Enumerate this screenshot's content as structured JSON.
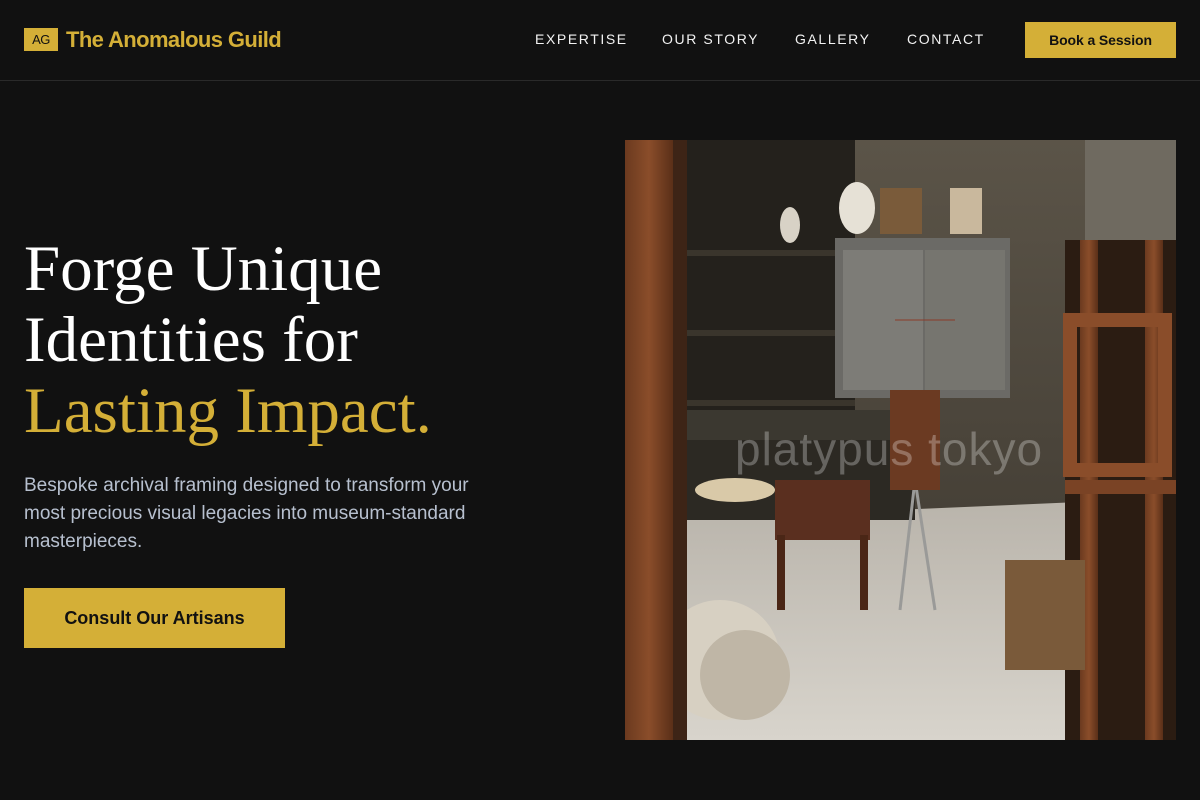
{
  "brand": {
    "mark": "AG",
    "name": "The Anomalous Guild"
  },
  "nav": {
    "links": [
      "EXPERTISE",
      "OUR STORY",
      "GALLERY",
      "CONTACT"
    ],
    "cta_label": "Book a Session"
  },
  "hero": {
    "title_line1": "Forge Unique",
    "title_line2": "Identities for",
    "title_accent": "Lasting Impact.",
    "subtitle": "Bespoke archival framing designed to transform your most precious visual legacies into museum-standard masterpieces.",
    "cta_label": "Consult Our Artisans",
    "image_watermark": "platypus tokyo"
  },
  "colors": {
    "background": "#111111",
    "accent": "#d4af37",
    "subtitle_text": "#b7c0cf"
  }
}
